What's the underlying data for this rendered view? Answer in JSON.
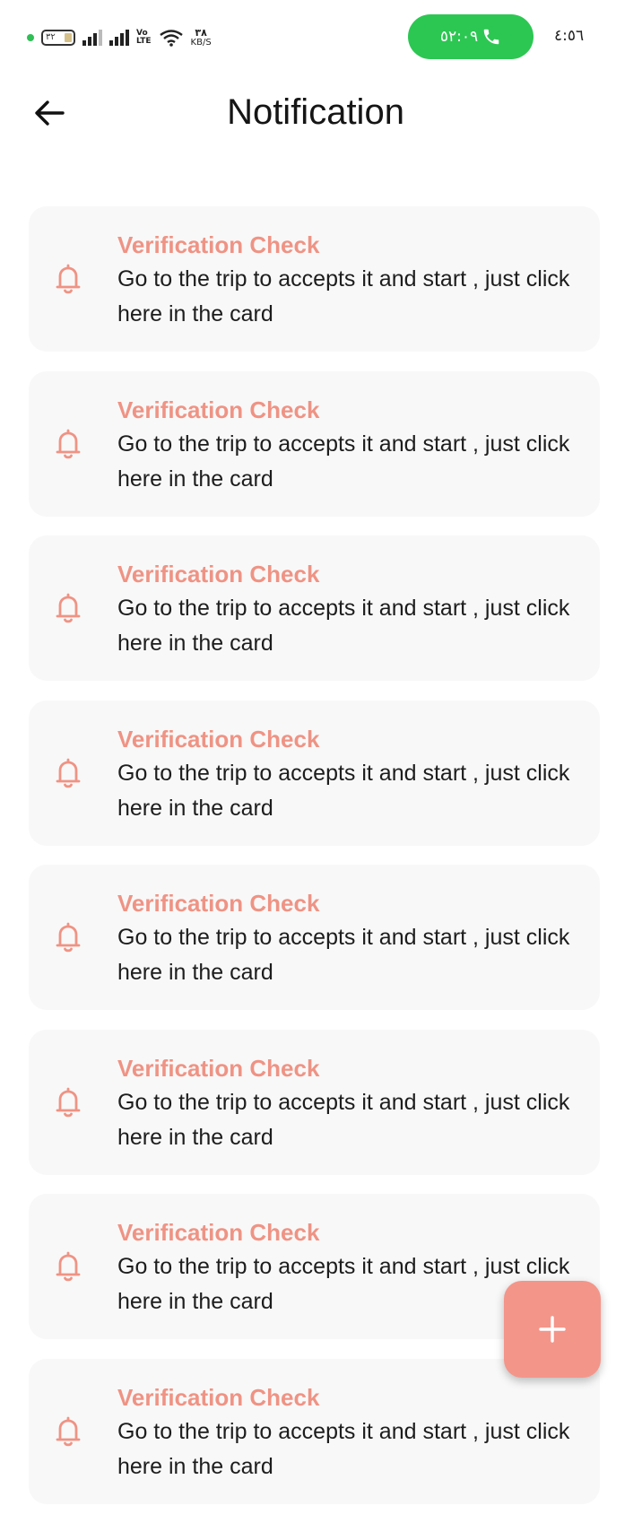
{
  "status_bar": {
    "battery_level": "٣٢",
    "network_type": "VoLTE",
    "network_line1": "Vo",
    "network_line2": "LTE",
    "speed_value": "٣٨",
    "speed_unit": "KB/S",
    "call_timer": "٥٢:٠٩",
    "clock": "٤:٥٦",
    "call_color": "#2cc752"
  },
  "app_bar": {
    "title": "Notification",
    "back_icon": "arrow-left-icon"
  },
  "notifications": [
    {
      "title": "Verification Check",
      "body": "Go to the trip to accepts it and start , just click here in the card"
    },
    {
      "title": "Verification Check",
      "body": "Go to the trip to accepts it and start , just click here in the card"
    },
    {
      "title": "Verification Check",
      "body": "Go to the trip to accepts it and start , just click here in the card"
    },
    {
      "title": "Verification Check",
      "body": "Go to the trip to accepts it and start , just click here in the card"
    },
    {
      "title": "Verification Check",
      "body": "Go to the trip to accepts it and start , just click here in the card"
    },
    {
      "title": "Verification Check",
      "body": "Go to the trip to accepts it and start , just click here in the card"
    },
    {
      "title": "Verification Check",
      "body": "Go to the trip to accepts it and start , just click here in the card"
    },
    {
      "title": "Verification Check",
      "body": "Go to the trip to accepts it and start , just click here in the card"
    }
  ],
  "fab": {
    "icon": "plus-icon",
    "label": "+"
  },
  "colors": {
    "accent": "#ef9384",
    "fab": "#f4958a",
    "card_background": "#f8f8f8"
  }
}
